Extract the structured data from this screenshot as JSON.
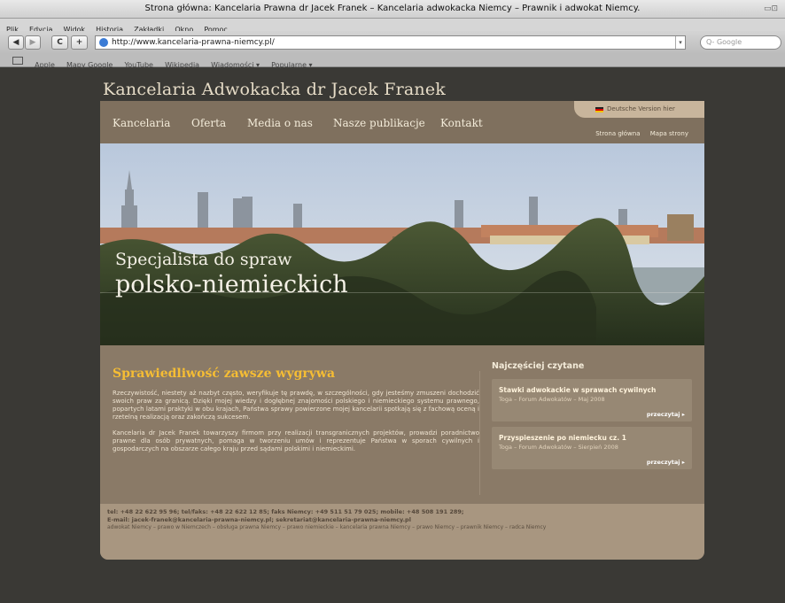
{
  "browser": {
    "window_title": "Strona główna: Kancelaria Prawna dr Jacek Franek – Kancelaria adwokacka Niemcy – Prawnik i adwokat Niemcy.",
    "menu": [
      "Plik",
      "Edycja",
      "Widok",
      "Historia",
      "Zakładki",
      "Okno",
      "Pomoc"
    ],
    "url": "http://www.kancelaria-prawna-niemcy.pl/",
    "search_placeholder": "Q- Google",
    "bookmarks": [
      "Apple",
      "Mapy Google",
      "YouTube",
      "Wikipedia",
      "Wiadomości ▾",
      "Popularne ▾"
    ]
  },
  "site": {
    "title": "Kancelaria Adwokacka dr Jacek Franek",
    "nav": [
      "Kancelaria",
      "Oferta",
      "Media o nas",
      "Nasze publikacje",
      "Kontakt"
    ],
    "lang_link": "Deutsche Version hier",
    "top_links": [
      "Strona główna",
      "Mapa strony"
    ]
  },
  "hero": {
    "tagline_line1": "Specjalista do spraw",
    "tagline_line2": "polsko-niemieckich"
  },
  "main": {
    "headline": "Sprawiedliwość zawsze wygrywa",
    "paragraph1": "Rzeczywistość, niestety aż nazbyt często, weryfikuje tę prawdę, w szczególności, gdy jesteśmy zmuszeni dochodzić swoich praw za granicą. Dzięki mojej wiedzy i dogłębnej znajomości polskiego i niemieckiego systemu prawnego, popartych latami praktyki w obu krajach, Państwa sprawy powierzone mojej kancelarii spotkają się z fachową oceną i rzetelną realizacją oraz zakończą sukcesem.",
    "paragraph2": "Kancelaria dr Jacek Franek towarzyszy firmom przy realizacji transgranicznych projektów, prowadzi poradnictwo prawne dla osób prywatnych, pomaga w tworzeniu umów i reprezentuje Państwa w sporach cywilnych i gospodarczych na obszarze całego kraju przed sądami polskimi i niemieckimi."
  },
  "sidebar": {
    "title": "Najczęściej czytane",
    "articles": [
      {
        "title": "Stawki adwokackie w sprawach cywilnych",
        "meta": "Toga – Forum Adwokatów – Maj 2008",
        "more": "przeczytaj ▸"
      },
      {
        "title": "Przyspieszenie po niemiecku cz. 1",
        "meta": "Toga – Forum Adwokatów – Sierpień 2008",
        "more": "przeczytaj ▸"
      }
    ]
  },
  "footer": {
    "line1": "tel: +48 22 622 95 96; tel/faks: +48 22 622 12 85; faks Niemcy: +49 511 51 79 025; mobile: +48 508 191 289;",
    "line2": "E-mail: jacek-franek@kancelaria-prawna-niemcy.pl; sekretariat@kancelaria-prawna-niemcy.pl",
    "line3": "adwokat Niemcy – prawo w Niemczech – obsługa prawna Niemcy – prawo niemieckie – kancelaria prawna Niemcy – prawo Niemcy – prawnik Niemcy – radca Niemcy"
  },
  "colors": {
    "page_background": "#3a3935",
    "panel": "#8a7a67",
    "headline": "#f5bd34",
    "footer": "#a89680"
  }
}
